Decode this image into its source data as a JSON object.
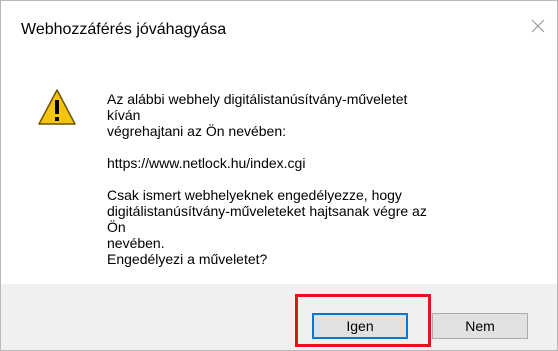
{
  "dialog": {
    "title": "Webhozzáférés jóváhagyása",
    "close_icon": "close-icon",
    "warning_icon": "warning-icon",
    "message": {
      "line1": "Az alábbi webhely digitálistanúsítvány-műveletet kíván",
      "line2": "végrehajtani az Ön nevében:",
      "url": "https://www.netlock.hu/index.cgi",
      "line3": "Csak ismert webhelyeknek engedélyezze, hogy",
      "line4": "digitálistanúsítvány-műveleteket hajtsanak végre az Ön",
      "line5": "nevében.",
      "question": "Engedélyezi a műveletet?"
    },
    "buttons": {
      "yes_label": "Igen",
      "no_label": "Nem"
    }
  },
  "colors": {
    "highlight": "#e0161e",
    "footer_bg": "#f0f0f0",
    "warning_fill": "#f5c50d"
  }
}
